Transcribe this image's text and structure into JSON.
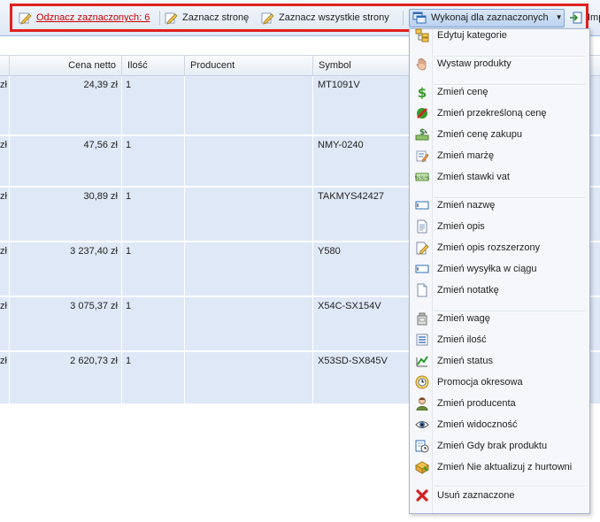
{
  "toolbar": {
    "deselect_label": "Odznacz zaznaczonych: 6",
    "select_page_label": "Zaznacz stronę",
    "select_all_label": "Zaznacz wszystkie strony",
    "actions_label": "Wykonaj dla zaznaczonych",
    "import_label": "Imp"
  },
  "grid": {
    "columns": [
      "Cena netto",
      "Ilość",
      "Producent",
      "Symbol"
    ],
    "rows": [
      {
        "prefix": "zł",
        "price": "24,39 zł",
        "qty": "1",
        "producer": "",
        "symbol": "MT1091V"
      },
      {
        "prefix": "zł",
        "price": "47,56 zł",
        "qty": "1",
        "producer": "",
        "symbol": "NMY-0240"
      },
      {
        "prefix": "zł",
        "price": "30,89 zł",
        "qty": "1",
        "producer": "",
        "symbol": "TAKMYS42427"
      },
      {
        "prefix": "zł",
        "price": "3 237,40 zł",
        "qty": "1",
        "producer": "",
        "symbol": "Y580"
      },
      {
        "prefix": "zł",
        "price": "3 075,37 zł",
        "qty": "1",
        "producer": "",
        "symbol": "X54C-SX154V"
      },
      {
        "prefix": "zł",
        "price": "2 620,73 zł",
        "qty": "1",
        "producer": "",
        "symbol": "X53SD-SX845V"
      }
    ]
  },
  "menu": {
    "items": [
      {
        "label": "Edytuj kategorie",
        "icon": "categories-icon"
      },
      {
        "label": "Wystaw produkty",
        "icon": "hand-icon"
      },
      {
        "label": "Zmień cenę",
        "icon": "dollar-icon"
      },
      {
        "label": "Zmień przekreśloną cenę",
        "icon": "strikethrough-price-icon"
      },
      {
        "label": "Zmień cenę zakupu",
        "icon": "purchase-price-icon"
      },
      {
        "label": "Zmień marżę",
        "icon": "margin-icon"
      },
      {
        "label": "Zmień stawki vat",
        "icon": "vat-icon"
      },
      {
        "label": "Zmień nazwę",
        "icon": "name-field-icon"
      },
      {
        "label": "Zmień opis",
        "icon": "document-icon"
      },
      {
        "label": "Zmień opis rozszerzony",
        "icon": "edit-document-icon"
      },
      {
        "label": "Zmień wysyłka w ciągu",
        "icon": "shipping-field-icon"
      },
      {
        "label": "Zmień notatkę",
        "icon": "note-icon"
      },
      {
        "label": "Zmień wagę",
        "icon": "weight-icon"
      },
      {
        "label": "Zmień ilość",
        "icon": "quantity-icon"
      },
      {
        "label": "Zmień status",
        "icon": "status-icon"
      },
      {
        "label": "Promocja okresowa",
        "icon": "promotion-icon"
      },
      {
        "label": "Zmień producenta",
        "icon": "producer-icon"
      },
      {
        "label": "Zmień widoczność",
        "icon": "eye-icon"
      },
      {
        "label": "Zmień Gdy brak produktu",
        "icon": "out-of-stock-icon"
      },
      {
        "label": "Zmień Nie aktualizuj z hurtowni",
        "icon": "wholesale-icon"
      },
      {
        "label": "Usuń zaznaczone",
        "icon": "delete-icon"
      }
    ]
  },
  "colors": {
    "highlight": "#e02020",
    "link": "#cc0000",
    "row_selected": "#dfe8f6"
  }
}
